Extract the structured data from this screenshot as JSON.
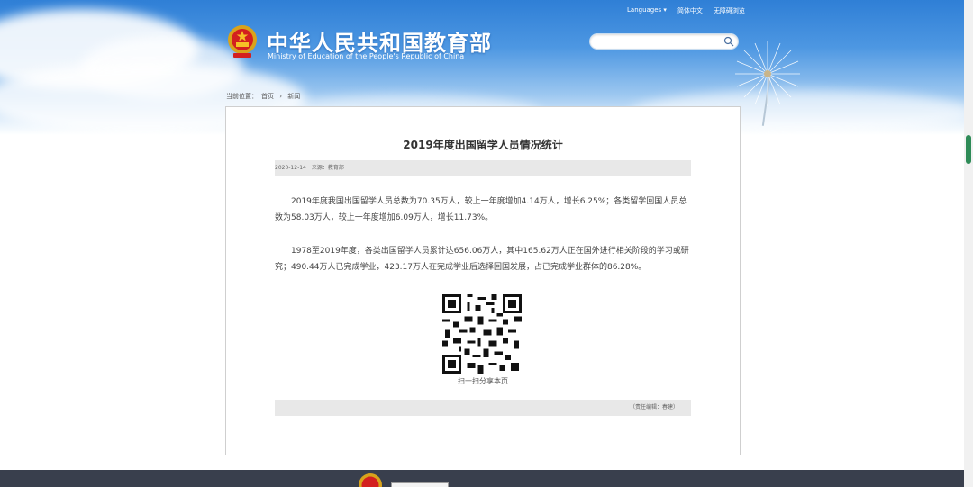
{
  "header": {
    "site_title": "中华人民共和国教育部",
    "site_subtitle": "Ministry of Education of the People's Republic of China",
    "top_links": [
      "Languages ▾",
      "简体中文",
      "无障碍浏览"
    ],
    "search_placeholder": ""
  },
  "breadcrumb": {
    "prefix": "当前位置：",
    "home": "首页",
    "separator": "›",
    "current": "新闻"
  },
  "article": {
    "title": "2019年度出国留学人员情况统计",
    "date": "2020-12-14",
    "source": "来源：教育部",
    "paragraphs": [
      "2019年度我国出国留学人员总数为70.35万人，较上一年度增加4.14万人，增长6.25%；各类留学回国人员总数为58.03万人，较上一年度增加6.09万人，增长11.73%。",
      "1978至2019年度，各类出国留学人员累计达656.06万人，其中165.62万人正在国外进行相关阶段的学习或研究；490.44万人已完成学业，423.17万人在完成学业后选择回国发展，占已完成学业群体的86.28%。"
    ],
    "qr_caption": "扫一扫分享本页",
    "editor": "（责任编辑：春建）"
  },
  "colors": {
    "accent": "#2f7fd6",
    "footer": "#393f4d",
    "scroll_thumb": "#2e8b57"
  }
}
